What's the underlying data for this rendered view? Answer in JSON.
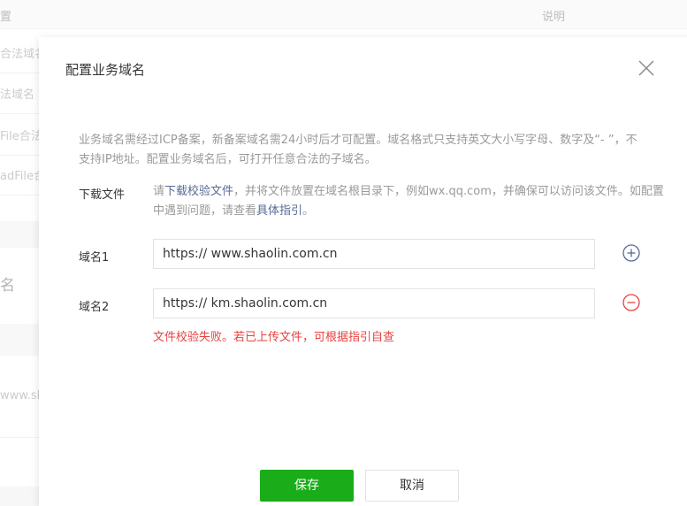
{
  "background": {
    "header_left": "置",
    "header_right": "说明",
    "rows": [
      "合法域名",
      "法域名",
      "File合法",
      "adFile合",
      "名",
      "www.sh"
    ]
  },
  "modal": {
    "title": "配置业务域名",
    "description": "业务域名需经过ICP备案，新备案域名需24小时后才可配置。域名格式只支持英文大小写字母、数字及“- ”，不支持IP地址。配置业务域名后，可打开任意合法的子域名。",
    "download": {
      "label": "下载文件",
      "text_1": "请",
      "link_1": "下载校验文件",
      "text_2": "，并将文件放置在域名根目录下，例如wx.qq.com，并确保可以访问该文件。如配置中遇到问题，请查看",
      "link_2": "具体指引",
      "text_3": "。"
    },
    "domains": [
      {
        "label": "域名1",
        "value": "https:// www.shaolin.com.cn",
        "action_icon": "plus-circle-icon"
      },
      {
        "label": "域名2",
        "value": "https:// km.shaolin.com.cn",
        "action_icon": "minus-circle-icon"
      }
    ],
    "error": "文件校验失败。若已上传文件，可根据指引自查",
    "save_label": "保存",
    "cancel_label": "取消"
  },
  "colors": {
    "primary": "#1aad19",
    "link": "#576b95",
    "error": "#e64340",
    "add_icon": "#576b95",
    "remove_icon": "#e64340"
  }
}
